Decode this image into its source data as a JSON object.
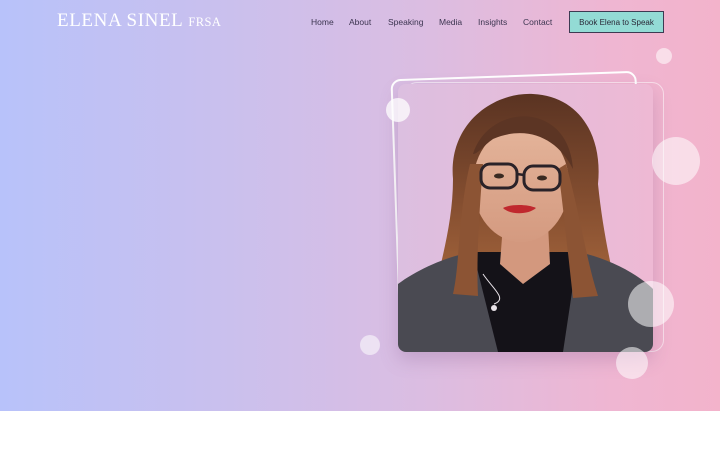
{
  "brand": {
    "name": "ELENA SINEL",
    "suffix": "FRSA"
  },
  "nav": {
    "items": [
      {
        "label": "Home",
        "id": "home"
      },
      {
        "label": "About",
        "id": "about"
      },
      {
        "label": "Speaking",
        "id": "speaking"
      },
      {
        "label": "Media",
        "id": "media"
      },
      {
        "label": "Insights",
        "id": "insights"
      },
      {
        "label": "Contact",
        "id": "contact"
      }
    ],
    "cta_label": "Book Elena to Speak"
  },
  "colors": {
    "cta_background": "#93dbd5",
    "gradient_start": "#b8c2fa",
    "gradient_end": "#f3b3cb"
  },
  "hero": {
    "image": "portrait-photo"
  }
}
